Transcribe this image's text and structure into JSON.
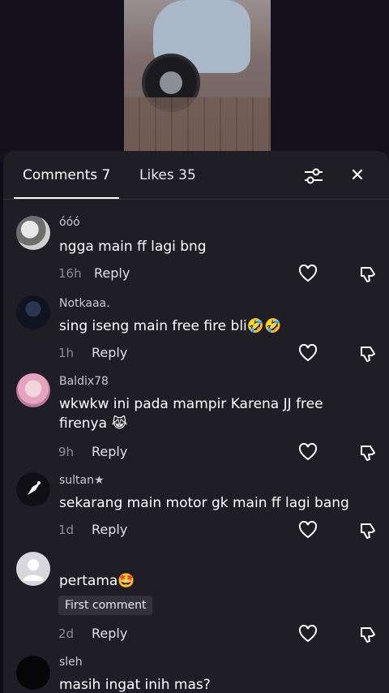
{
  "tabs": {
    "comments": "Comments 7",
    "likes": "Likes 35"
  },
  "comments": [
    {
      "username": "óóó",
      "text": "ngga main ff lagi bng",
      "time": "16h",
      "reply": "Reply"
    },
    {
      "username": "Notkaaa.",
      "text": "sing iseng main free fire bli🤣🤣",
      "time": "1h",
      "reply": "Reply"
    },
    {
      "username": "Baldix78",
      "text": "wkwkw ini pada mampir Karena JJ free firenya 😹",
      "time": "9h",
      "reply": "Reply"
    },
    {
      "username": "sultan★",
      "text": "sekarang main motor gk main ff lagi bang",
      "time": "1d",
      "reply": "Reply"
    },
    {
      "username": "",
      "text": "pertama🤩",
      "badge": "First comment",
      "time": "2d",
      "reply": "Reply"
    },
    {
      "username": "sleh",
      "text": "masih ingat inih mas?",
      "time": "",
      "reply": ""
    }
  ],
  "colors": {
    "sheet": "#1f1e25",
    "background": "#0e0c14",
    "muted": "#8d8c95"
  }
}
